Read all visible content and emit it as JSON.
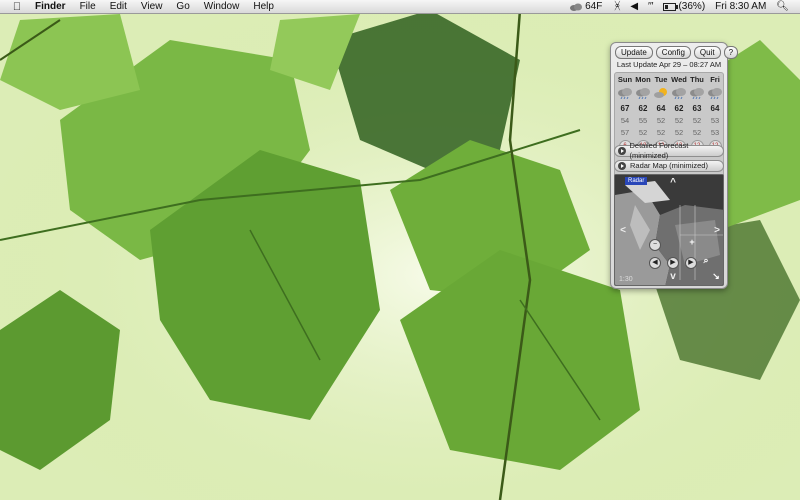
{
  "menubar": {
    "apple_icon": "apple-icon",
    "items": [
      "Finder",
      "File",
      "Edit",
      "View",
      "Go",
      "Window",
      "Help"
    ],
    "status": {
      "weather_temp": "64F",
      "battery_pct": "(36%)",
      "battery_level": 0.36,
      "clock": "Fri 8:30 AM"
    }
  },
  "widget": {
    "buttons": {
      "update": "Update",
      "config": "Config",
      "quit": "Quit",
      "help": "?"
    },
    "last_update": "Last Update Apr 29 – 08:27 AM",
    "forecast": [
      {
        "day": "Sun",
        "icon": "rain-cloud-icon",
        "hi": "67",
        "lo": "54",
        "precip": "57",
        "uv": "6"
      },
      {
        "day": "Mon",
        "icon": "rain-cloud-icon",
        "hi": "62",
        "lo": "55",
        "precip": "52",
        "uv": "12"
      },
      {
        "day": "Tue",
        "icon": "partly-sunny-icon",
        "hi": "64",
        "lo": "52",
        "precip": "52",
        "uv": "12"
      },
      {
        "day": "Wed",
        "icon": "rain-cloud-icon",
        "hi": "62",
        "lo": "52",
        "precip": "52",
        "uv": "12"
      },
      {
        "day": "Thu",
        "icon": "rain-cloud-icon",
        "hi": "63",
        "lo": "52",
        "precip": "52",
        "uv": "12"
      },
      {
        "day": "Fri",
        "icon": "rain-cloud-icon",
        "hi": "64",
        "lo": "53",
        "precip": "53",
        "uv": "12"
      }
    ],
    "detailed_forecast": "Detailed Forecast (minimized)",
    "radar_map": "Radar Map (minimized)",
    "radar": {
      "label": "Radar",
      "time": "1:30",
      "nav": {
        "left": "<",
        "right": ">",
        "up": "^",
        "down": "v"
      }
    }
  },
  "colors": {
    "leaf_dark": "#4f8f2a",
    "leaf_mid": "#6fae3a",
    "leaf_light": "#9ccf5a",
    "radar_label_bg": "#2946b8"
  }
}
